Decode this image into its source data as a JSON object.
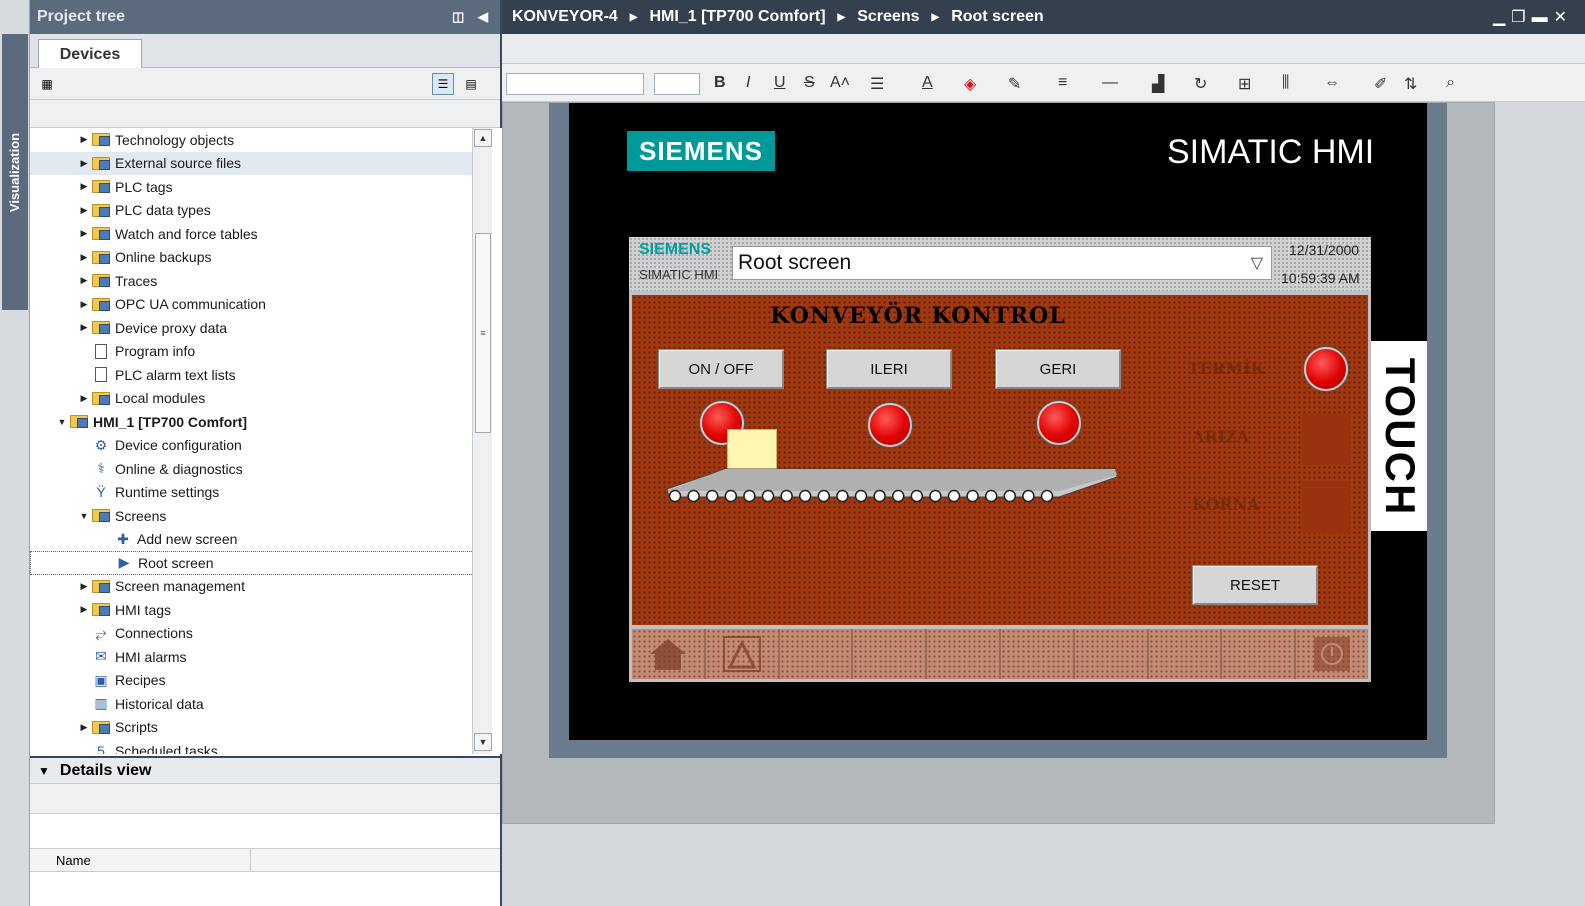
{
  "left_strip": {
    "tab_label": "Visualization"
  },
  "project_tree": {
    "title": "Project tree",
    "tab_label": "Devices",
    "items": [
      {
        "label": "Technology objects",
        "expander": "collapsed",
        "indent": 1,
        "icon": "technology-objects-icon"
      },
      {
        "label": "External source files",
        "expander": "collapsed",
        "indent": 1,
        "icon": "folder-icon",
        "highlight": true
      },
      {
        "label": "PLC tags",
        "expander": "collapsed",
        "indent": 1,
        "icon": "plc-tags-icon"
      },
      {
        "label": "PLC data types",
        "expander": "collapsed",
        "indent": 1,
        "icon": "plc-data-types-icon"
      },
      {
        "label": "Watch and force tables",
        "expander": "collapsed",
        "indent": 1,
        "icon": "watch-tables-icon"
      },
      {
        "label": "Online backups",
        "expander": "collapsed",
        "indent": 1,
        "icon": "online-backups-icon"
      },
      {
        "label": "Traces",
        "expander": "collapsed",
        "indent": 1,
        "icon": "traces-icon"
      },
      {
        "label": "OPC UA communication",
        "expander": "collapsed",
        "indent": 1,
        "icon": "opc-ua-icon"
      },
      {
        "label": "Device proxy data",
        "expander": "collapsed",
        "indent": 1,
        "icon": "device-proxy-icon"
      },
      {
        "label": "Program info",
        "expander": "none",
        "indent": 1,
        "icon": "program-info-icon"
      },
      {
        "label": "PLC alarm text lists",
        "expander": "none",
        "indent": 1,
        "icon": "document-icon"
      },
      {
        "label": "Local modules",
        "expander": "collapsed",
        "indent": 1,
        "icon": "local-modules-icon"
      },
      {
        "label": "HMI_1 [TP700 Comfort]",
        "expander": "expanded",
        "indent": 0,
        "icon": "hmi-device-icon",
        "bold": true
      },
      {
        "label": "Device configuration",
        "expander": "none",
        "indent": 1,
        "icon": "device-config-icon"
      },
      {
        "label": "Online & diagnostics",
        "expander": "none",
        "indent": 1,
        "icon": "diagnostics-icon"
      },
      {
        "label": "Runtime settings",
        "expander": "none",
        "indent": 1,
        "icon": "runtime-settings-icon"
      },
      {
        "label": "Screens",
        "expander": "expanded",
        "indent": 1,
        "icon": "folder-icon"
      },
      {
        "label": "Add new screen",
        "expander": "none",
        "indent": 2,
        "icon": "add-screen-icon"
      },
      {
        "label": "Root screen",
        "expander": "none",
        "indent": 2,
        "icon": "screen-icon",
        "selected": true
      },
      {
        "label": "Screen management",
        "expander": "collapsed",
        "indent": 1,
        "icon": "screen-management-icon"
      },
      {
        "label": "HMI tags",
        "expander": "collapsed",
        "indent": 1,
        "icon": "hmi-tags-icon"
      },
      {
        "label": "Connections",
        "expander": "none",
        "indent": 1,
        "icon": "connections-icon"
      },
      {
        "label": "HMI alarms",
        "expander": "none",
        "indent": 1,
        "icon": "hmi-alarms-icon"
      },
      {
        "label": "Recipes",
        "expander": "none",
        "indent": 1,
        "icon": "recipes-icon"
      },
      {
        "label": "Historical data",
        "expander": "none",
        "indent": 1,
        "icon": "historical-data-icon"
      },
      {
        "label": "Scripts",
        "expander": "collapsed",
        "indent": 1,
        "icon": "scripts-icon"
      },
      {
        "label": "Scheduled tasks",
        "expander": "none",
        "indent": 1,
        "icon": "scheduled-tasks-icon"
      }
    ]
  },
  "details_view": {
    "title": "Details view",
    "column_name": "Name"
  },
  "editor": {
    "breadcrumb": [
      "KONVEYOR-4",
      "HMI_1 [TP700 Comfort]",
      "Screens",
      "Root screen"
    ]
  },
  "device": {
    "brand": "SIEMENS",
    "model_label": "SIMATIC HMI",
    "touch_label": "TOUCH"
  },
  "hmi_screen": {
    "header_brand": "SIEMENS",
    "header_model": "SIMATIC HMI",
    "screen_selector_value": "Root screen",
    "date": "12/31/2000",
    "time": "10:59:39 AM",
    "title": "KONVEYÖR  KONTROL",
    "buttons": {
      "on_off": "ON / OFF",
      "ileri": "ILERI",
      "geri": "GERI",
      "reset": "RESET"
    },
    "indicators": {
      "termik": "TERMİK",
      "ariza": "ARIZA",
      "korna": "KORNA"
    },
    "colors": {
      "background": "#a2380f",
      "lamp_on": "#e00000",
      "box": "#fff5b0"
    }
  }
}
